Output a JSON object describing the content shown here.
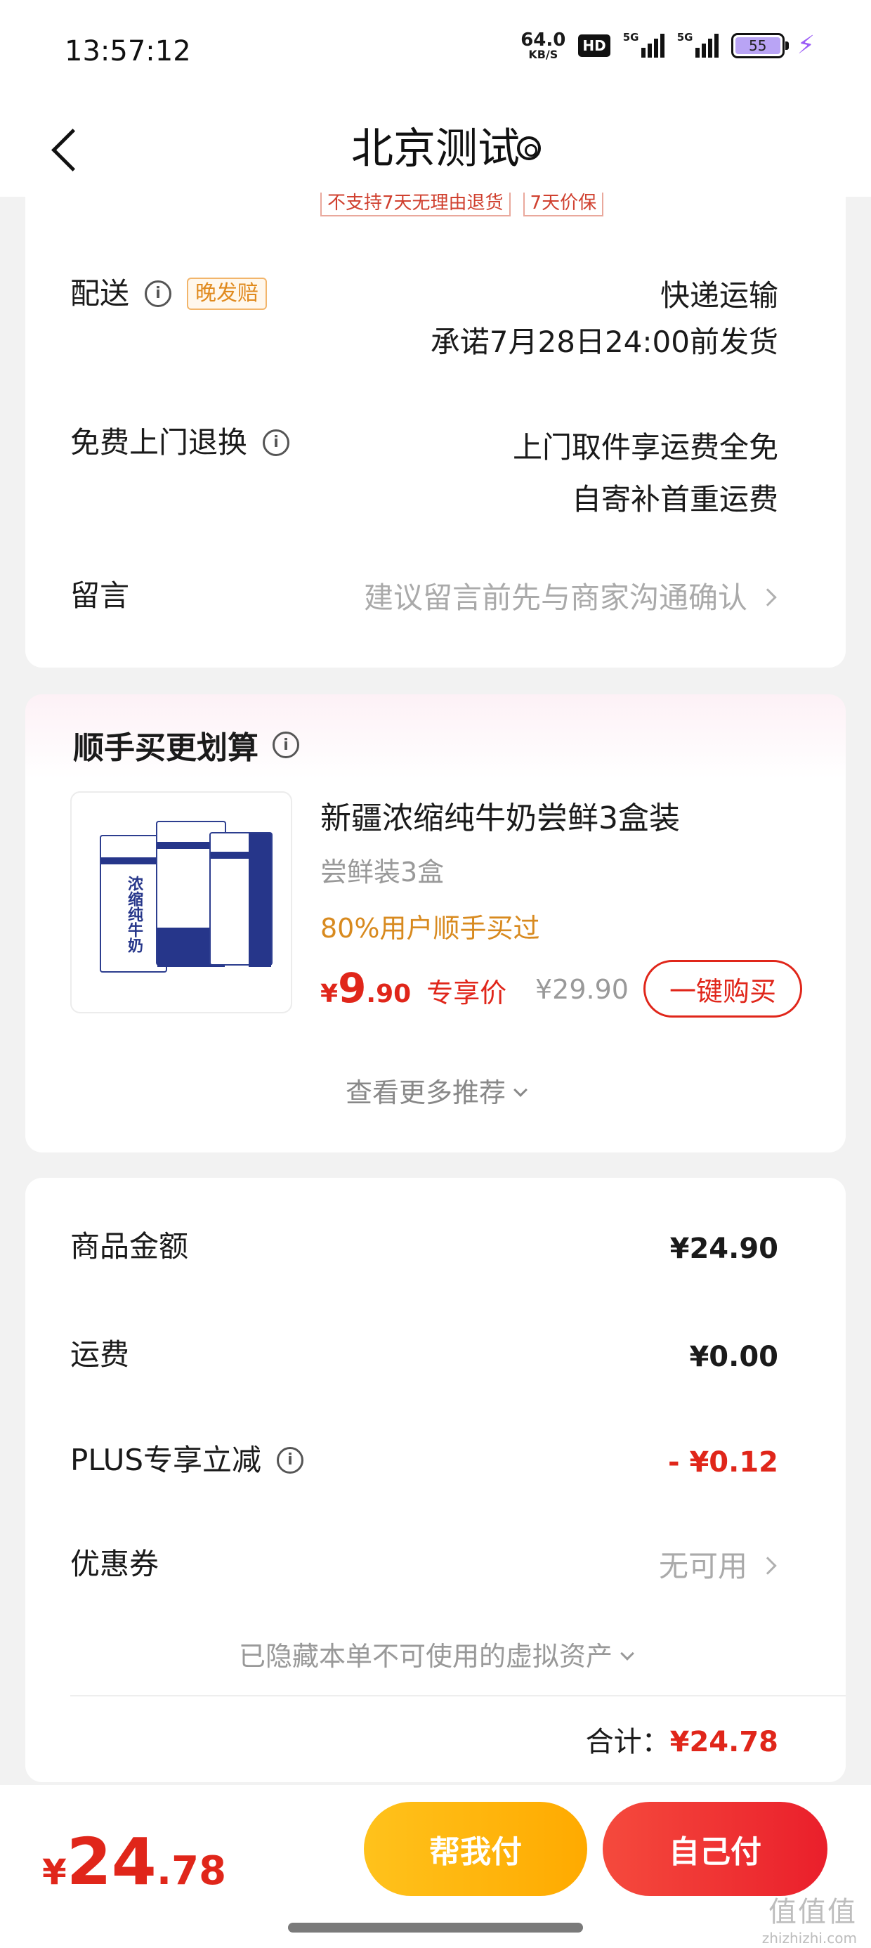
{
  "status_bar": {
    "time": "13:57:12",
    "net_speed": "64.0",
    "net_unit": "KB/S",
    "hd": "HD",
    "sig1": "5G",
    "sig2": "5G",
    "battery": "55"
  },
  "nav": {
    "title": "北京测试"
  },
  "delivery_card": {
    "tags_peek": [
      "不支持7天无理由退货",
      "7天价保"
    ],
    "shipping": {
      "label": "配送",
      "badge": "晚发赔",
      "method": "快递运输",
      "promise": "承诺7月28日24:00前发货"
    },
    "return": {
      "label": "免费上门退换",
      "line1": "上门取件享运费全免",
      "line2": "自寄补首重运费"
    },
    "message": {
      "label": "留言",
      "placeholder": "建议留言前先与商家沟通确认"
    }
  },
  "addon_card": {
    "title": "顺手买更划算",
    "product": {
      "name": "新疆浓缩纯牛奶尝鲜3盒装",
      "spec": "尝鲜装3盒",
      "popularity": "80%用户顺手买过",
      "price_symbol": "¥",
      "price_int": "9",
      "price_dec": ".90",
      "price_tag": "专享价",
      "original_price": "¥29.90",
      "buy_label": "一键购买",
      "image_text": "浓缩纯牛奶"
    },
    "more": "查看更多推荐"
  },
  "summary_card": {
    "rows": [
      {
        "label": "商品金额",
        "value": "¥24.90"
      },
      {
        "label": "运费",
        "value": "¥0.00"
      },
      {
        "label": "PLUS专享立减",
        "value": "- ¥0.12"
      },
      {
        "label": "优惠券",
        "value": "无可用"
      }
    ],
    "hidden_assets": "已隐藏本单不可使用的虚拟资产",
    "subtotal_label": "合计：",
    "subtotal_value": "¥24.78"
  },
  "bottom_bar": {
    "total_symbol": "¥",
    "total_int": "24",
    "total_dec": ".78",
    "help_pay": "帮我付",
    "self_pay": "自己付"
  },
  "watermark": {
    "big": "值值值",
    "small": "zhizhizhi.com"
  },
  "colors": {
    "accent_red": "#e0261a",
    "help_yellow": "#ffb300",
    "popularity_orange": "#d88a1f"
  }
}
